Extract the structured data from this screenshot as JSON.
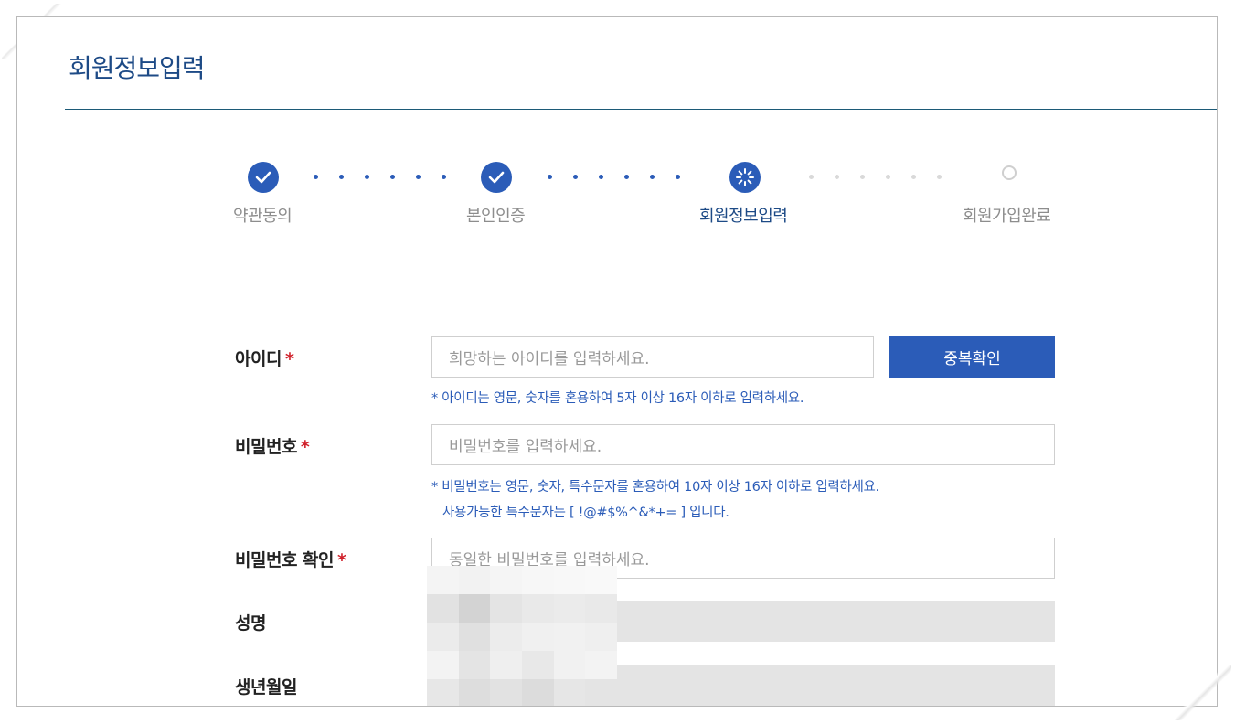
{
  "page": {
    "title": "회원정보입력"
  },
  "steps": [
    {
      "label": "약관동의",
      "state": "done"
    },
    {
      "label": "본인인증",
      "state": "done"
    },
    {
      "label": "회원정보입력",
      "state": "current"
    },
    {
      "label": "회원가입완료",
      "state": "pending"
    }
  ],
  "form": {
    "id": {
      "label": "아이디",
      "required": "*",
      "placeholder": "희망하는 아이디를 입력하세요.",
      "check_button": "중복확인",
      "hint": "* 아이디는 영문, 숫자를 혼용하여 5자 이상 16자 이하로 입력하세요."
    },
    "password": {
      "label": "비밀번호",
      "required": "*",
      "placeholder": "비밀번호를 입력하세요.",
      "hint_line1": "* 비밀번호는 영문, 숫자, 특수문자를 혼용하여 10자 이상 16자 이하로 입력하세요.",
      "hint_line2": "사용가능한 특수문자는 [ !@#$%^&*+= ] 입니다."
    },
    "password_confirm": {
      "label": "비밀번호 확인",
      "required": "*",
      "placeholder": "동일한 비밀번호를 입력하세요."
    },
    "name": {
      "label": "성명"
    },
    "birthdate": {
      "label": "생년월일"
    }
  },
  "colors": {
    "accent": "#2b5cb8",
    "title": "#1d4a86",
    "required": "#d0202a"
  }
}
